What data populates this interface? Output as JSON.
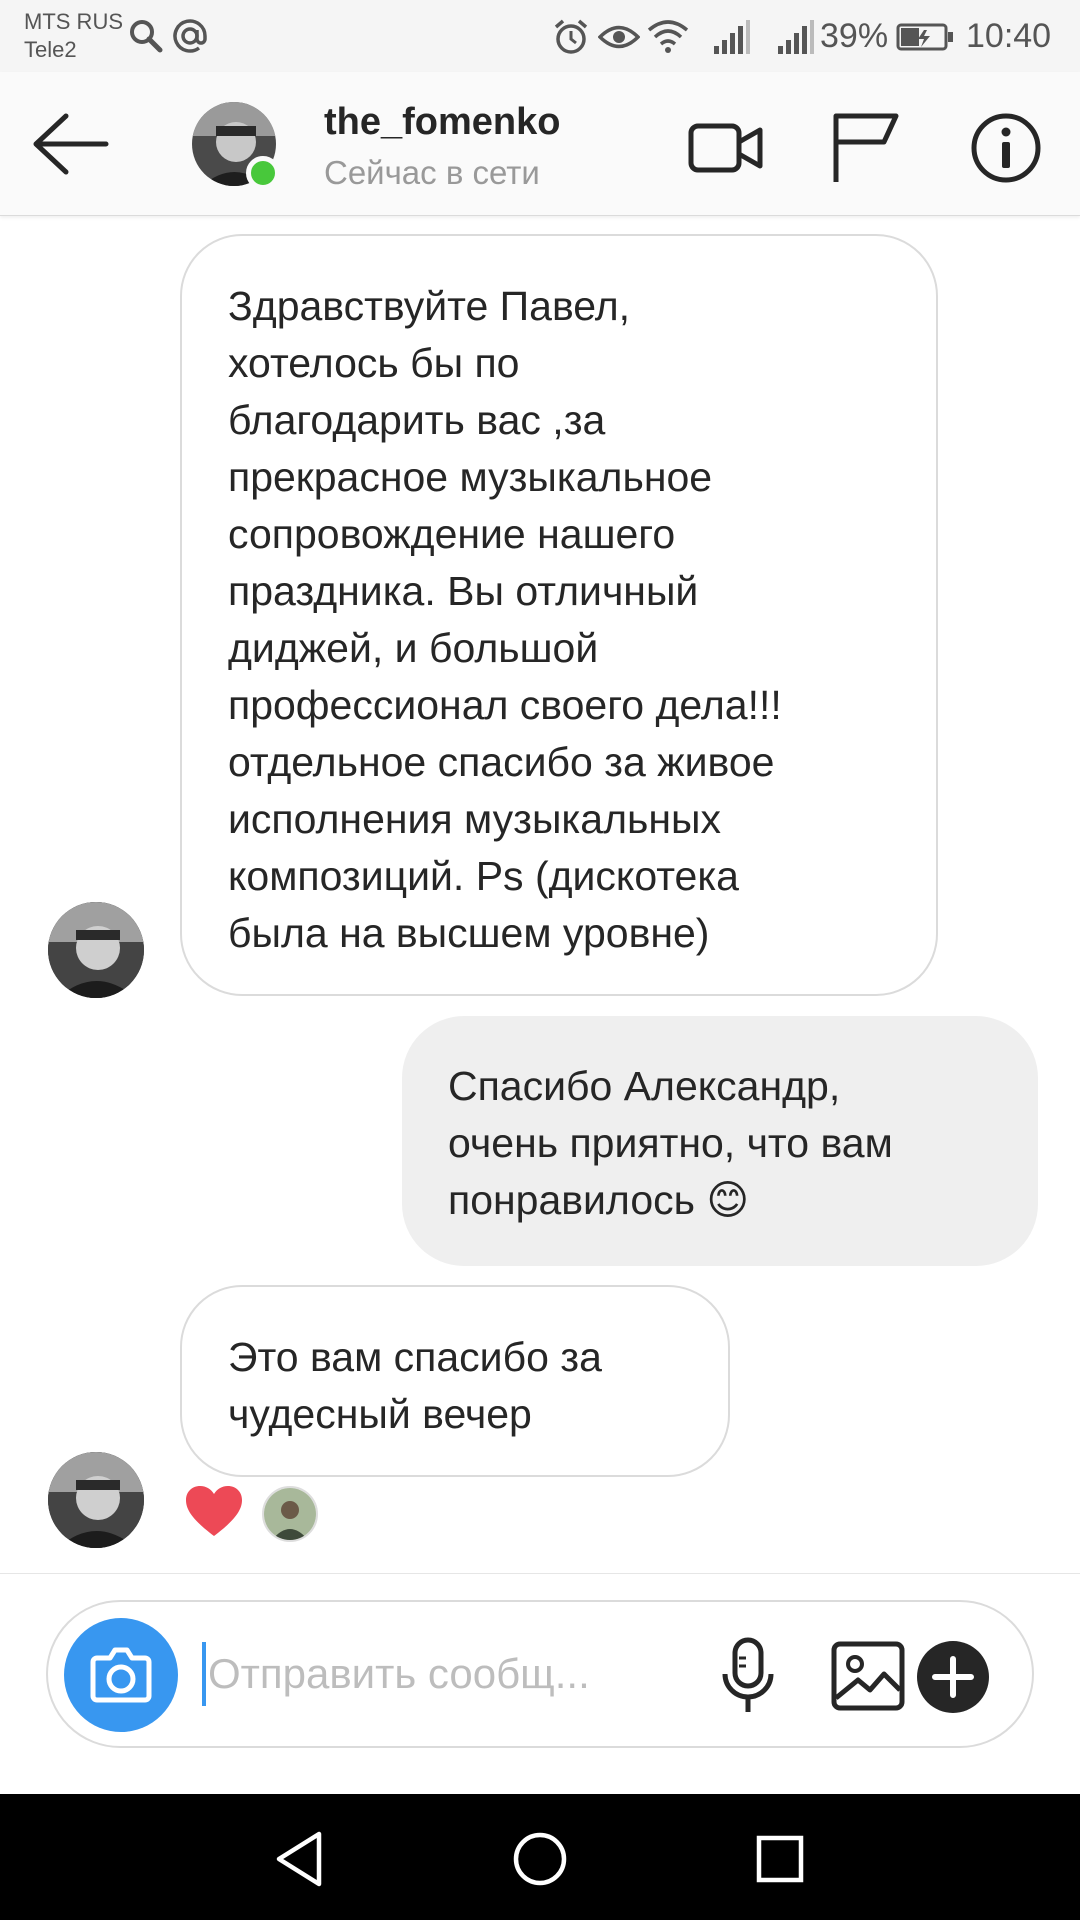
{
  "status_bar": {
    "carrier_1": "MTS RUS",
    "carrier_2": "Tele2",
    "battery": "39%",
    "time": "10:40"
  },
  "header": {
    "username": "the_fomenko",
    "status": "Сейчас в сети"
  },
  "messages": [
    {
      "direction": "incoming",
      "text": "Здравствуйте Павел,\nхотелось бы по\nблагодарить вас ,за\nпрекрасное музыкальное\nсопровождение нашего\nпраздника. Вы отличный\nдиджей, и большой\nпрофессионал своего дела!!!\nотдельное спасибо за живое\nисполнения музыкальных\nкомпозиций. Ps (дискотека\nбыла на высшем уровне)"
    },
    {
      "direction": "outgoing",
      "text": "Спасибо Александр,\nочень приятно, что вам\nпонравилось 😊"
    },
    {
      "direction": "incoming",
      "text": "Это вам спасибо за\nчудесный вечер",
      "reaction": "heart"
    }
  ],
  "composer": {
    "placeholder": "Отправить сообщ..."
  },
  "colors": {
    "accent": "#3897f0",
    "online": "#48c83b",
    "heart": "#ed4956",
    "incoming_border": "#dbdbdb",
    "outgoing_bg": "#efefef"
  },
  "icons": [
    "back-arrow-icon",
    "video-call-icon",
    "flag-icon",
    "info-icon",
    "camera-icon",
    "microphone-icon",
    "gallery-icon",
    "plus-icon",
    "heart-icon"
  ]
}
